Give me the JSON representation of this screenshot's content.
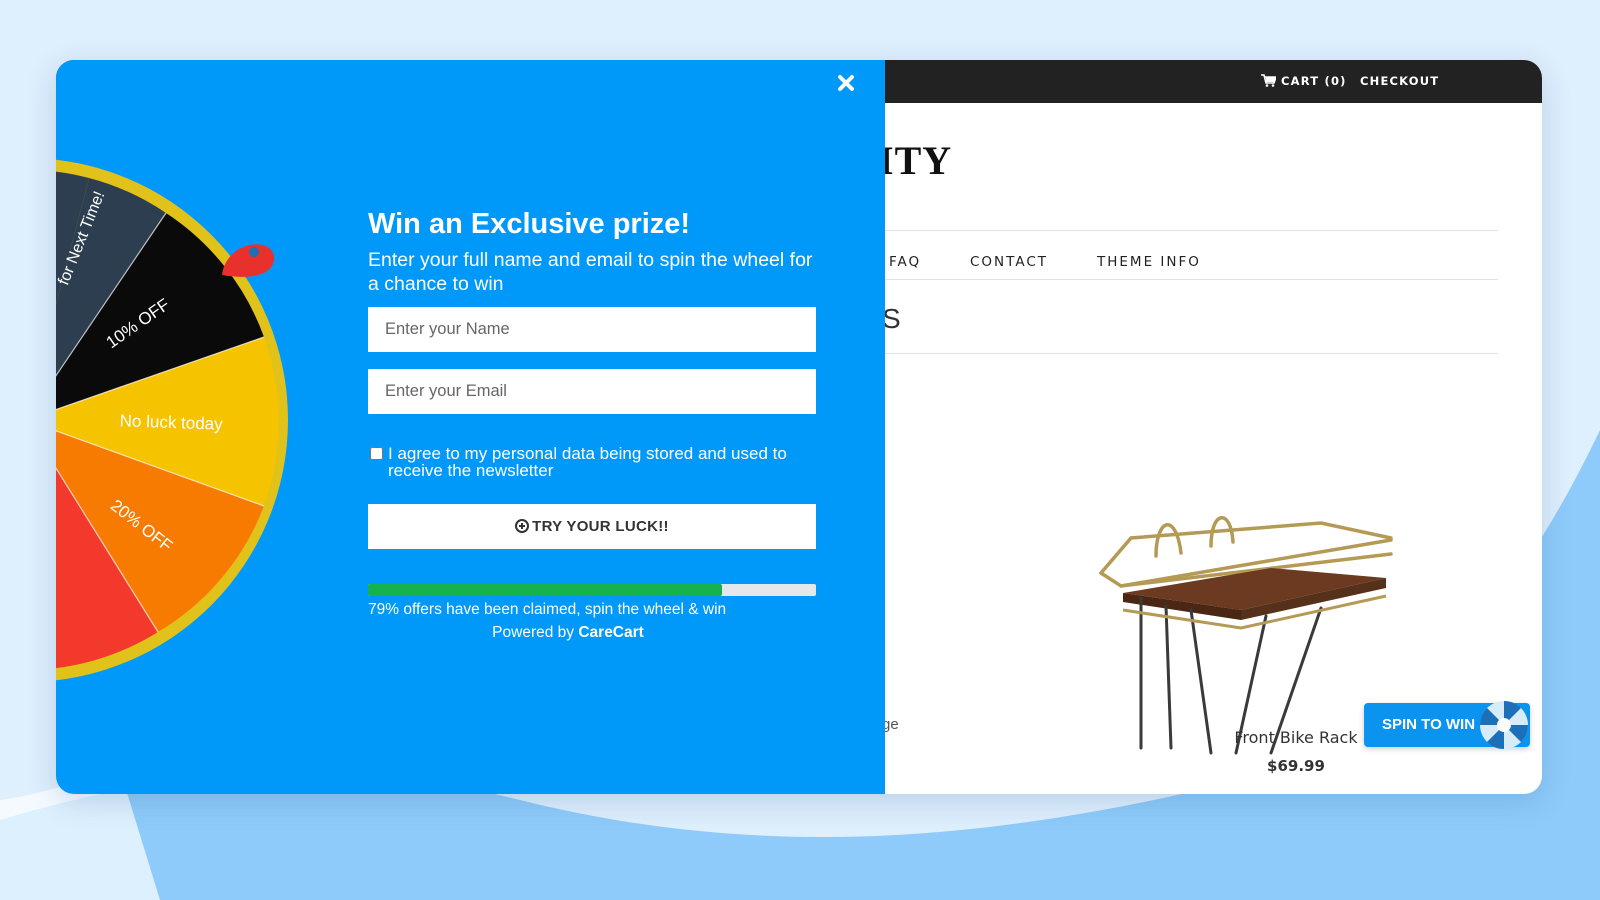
{
  "popup": {
    "headline": "Win an Exclusive prize!",
    "subline": "Enter your full name and email to spin the wheel for a chance to win",
    "name_placeholder": "Enter your Name",
    "email_placeholder": "Enter your Email",
    "agree_label": "I agree to my personal data being stored and used to receive the newsletter",
    "try_button": "TRY YOUR LUCK!!",
    "progress_percent": 79,
    "claim_text": "79% offers have been claimed, spin the wheel & win",
    "powered_prefix": "Powered by",
    "powered_brand": "CareCart",
    "wheel_segments": [
      "for Next Time!",
      "10% OFF",
      "No luck today",
      "20% OFF"
    ],
    "colors": {
      "background": "#0099fa",
      "progress_fill": "#16b24d",
      "wheel_rim": "#e1c21a",
      "pointer": "#e8302c"
    }
  },
  "store": {
    "cart_label": "CART (0)",
    "checkout_label": "CHECKOUT",
    "title_fragment": "ITY",
    "nav": [
      "FAQ",
      "CONTACT",
      "THEME INFO"
    ],
    "heading_fragment": "S",
    "left_product_fragment": "ge",
    "product": {
      "name": "Front Bike Rack",
      "price": "$69.99"
    },
    "spin_button": "SPIN TO WIN"
  }
}
